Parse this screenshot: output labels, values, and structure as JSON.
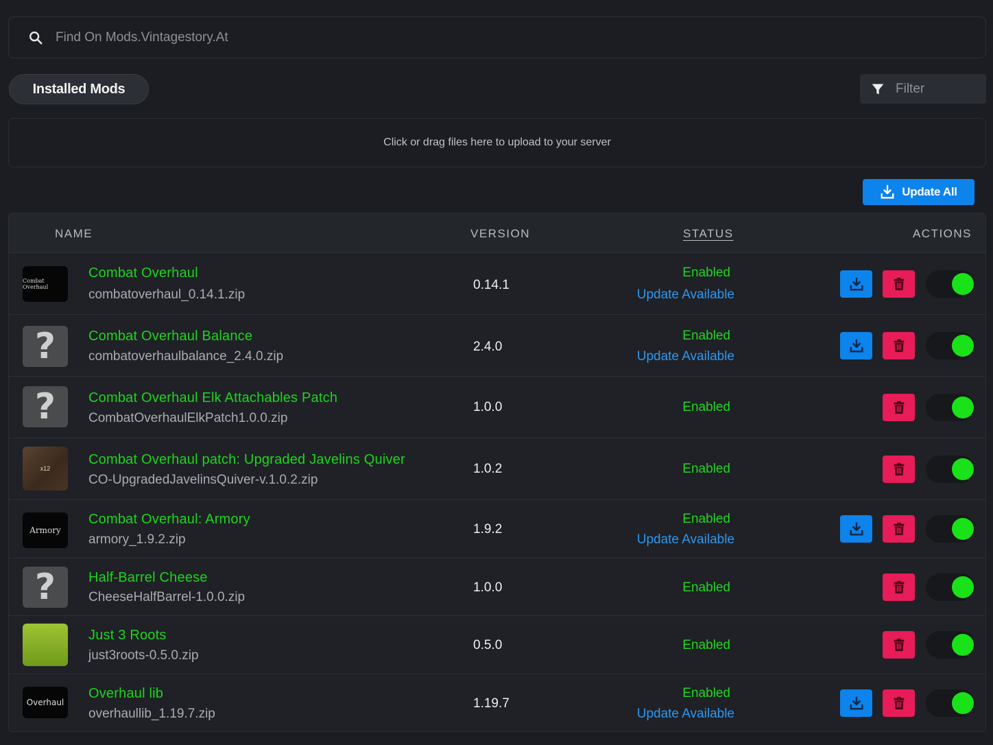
{
  "search": {
    "placeholder": "Find On Mods.Vintagestory.At"
  },
  "tabs": {
    "installed_label": "Installed Mods"
  },
  "filter": {
    "label": "Filter"
  },
  "dropzone": {
    "text": "Click or drag files here to upload to your server"
  },
  "toolbar": {
    "update_all_label": "Update All"
  },
  "table": {
    "columns": {
      "name": "NAME",
      "version": "VERSION",
      "status": "STATUS",
      "actions": "ACTIONS"
    },
    "rows": [
      {
        "title": "Combat Overhaul",
        "file": "combatoverhaul_0.14.1.zip",
        "version": "0.14.1",
        "status": "Enabled",
        "update": "Update Available",
        "thumb_text": "Combat Overhaul"
      },
      {
        "title": "Combat Overhaul Balance",
        "file": "combatoverhaulbalance_2.4.0.zip",
        "version": "2.4.0",
        "status": "Enabled",
        "update": "Update Available",
        "thumb_text": "?"
      },
      {
        "title": "Combat Overhaul Elk Attachables Patch",
        "file": "CombatOverhaulElkPatch1.0.0.zip",
        "version": "1.0.0",
        "status": "Enabled",
        "update": "",
        "thumb_text": "?"
      },
      {
        "title": "Combat Overhaul patch: Upgraded Javelins Quiver",
        "file": "CO-UpgradedJavelinsQuiver-v.1.0.2.zip",
        "version": "1.0.2",
        "status": "Enabled",
        "update": "",
        "thumb_text": "x12"
      },
      {
        "title": "Combat Overhaul: Armory",
        "file": "armory_1.9.2.zip",
        "version": "1.9.2",
        "status": "Enabled",
        "update": "Update Available",
        "thumb_text": "Armory"
      },
      {
        "title": "Half-Barrel Cheese",
        "file": "CheeseHalfBarrel-1.0.0.zip",
        "version": "1.0.0",
        "status": "Enabled",
        "update": "",
        "thumb_text": "?"
      },
      {
        "title": "Just 3 Roots",
        "file": "just3roots-0.5.0.zip",
        "version": "0.5.0",
        "status": "Enabled",
        "update": "",
        "thumb_text": ""
      },
      {
        "title": "Overhaul lib",
        "file": "overhaullib_1.19.7.zip",
        "version": "1.19.7",
        "status": "Enabled",
        "update": "Update Available",
        "thumb_text": "Overhaul"
      }
    ]
  },
  "colors": {
    "accent_blue": "#0d83ec",
    "delete_red": "#e81c58",
    "enabled_green": "#22d422",
    "toggle_on": "#19e219",
    "update_link": "#2f97f0"
  }
}
